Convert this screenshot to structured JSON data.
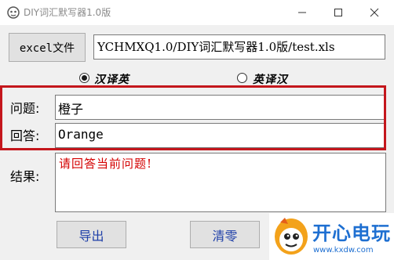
{
  "window": {
    "title": "DIY词汇默写器1.0版",
    "min_icon": "minimize-icon",
    "max_icon": "maximize-icon",
    "close_icon": "close-icon"
  },
  "toolbar": {
    "excel_button": "excel文件",
    "file_path": "YCHMXQ1.0/DIY词汇默写器1.0版/test.xls"
  },
  "mode": {
    "options": [
      {
        "label": "汉译英",
        "selected": true
      },
      {
        "label": "英译汉",
        "selected": false
      }
    ]
  },
  "form": {
    "question_label": "问题:",
    "question_value": "橙子",
    "answer_label": "回答:",
    "answer_value": "Orange",
    "result_label": "结果:",
    "result_text": "请回答当前问题!"
  },
  "actions": {
    "export_label": "导出",
    "clear_label": "清零"
  },
  "watermark": {
    "name": "开心电玩",
    "url": "www.kxdw.com"
  },
  "colors": {
    "highlight": "#c4161c",
    "result_text": "#d40000",
    "button_text": "#1e3fa8",
    "watermark": "#1e6fd1"
  }
}
